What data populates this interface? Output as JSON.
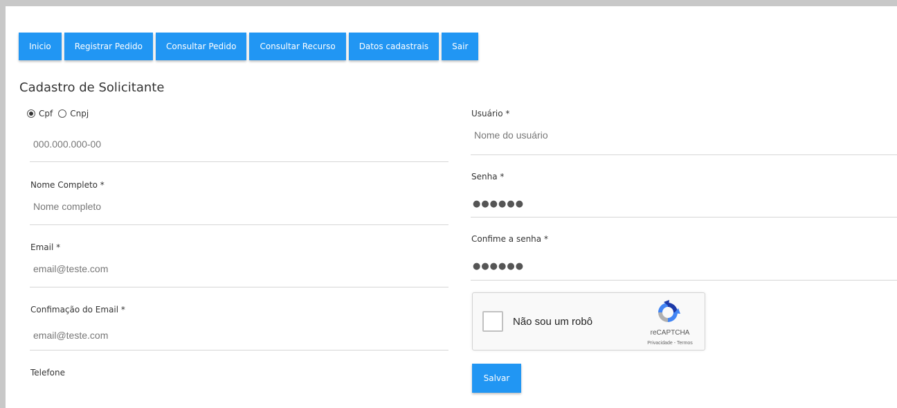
{
  "nav": {
    "items": [
      "Inicio",
      "Registrar Pedido",
      "Consultar Pedido",
      "Consultar Recurso",
      "Datos cadastrais",
      "Sair"
    ]
  },
  "page": {
    "title": "Cadastro de Solicitante"
  },
  "doc_type": {
    "options": [
      "Cpf",
      "Cnpj"
    ],
    "selected": "Cpf"
  },
  "left": {
    "cpf": {
      "placeholder": "000.000.000-00"
    },
    "nome": {
      "label": "Nome Completo *",
      "placeholder": "Nome completo"
    },
    "email": {
      "label": "Email *",
      "placeholder": "email@teste.com"
    },
    "confirm_email": {
      "label": "Confimação do Email *",
      "placeholder": "email@teste.com"
    },
    "telefone": {
      "label": "Telefone"
    }
  },
  "right": {
    "usuario": {
      "label": "Usuário *",
      "placeholder": "Nome do usuário"
    },
    "senha": {
      "label": "Senha *",
      "value": "●●●●●●"
    },
    "confirm_senha": {
      "label": "Confime a senha *",
      "value": "●●●●●●"
    }
  },
  "captcha": {
    "label": "Não sou um robô",
    "brand": "reCAPTCHA",
    "terms": "Privacidade - Termos",
    "icon": "recaptcha-logo-icon"
  },
  "actions": {
    "save": "Salvar"
  },
  "colors": {
    "primary": "#2196f3",
    "page_bg": "#c8c8c8"
  }
}
